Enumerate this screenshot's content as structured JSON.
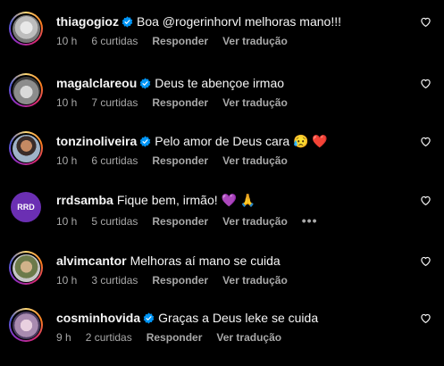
{
  "comments": [
    {
      "username": "thiagogioz",
      "verified": true,
      "text": "Boa @rogerinhorvl melhoras mano!!!",
      "time": "10 h",
      "likes": "6 curtidas",
      "reply": "Responder",
      "translate": "Ver tradução"
    },
    {
      "username": "magalclareou",
      "verified": true,
      "text": "Deus te abençoe irmao",
      "time": "10 h",
      "likes": "7 curtidas",
      "reply": "Responder",
      "translate": "Ver tradução"
    },
    {
      "username": "tonzinoliveira",
      "verified": true,
      "text": "Pelo amor de Deus cara 😥 ❤️",
      "time": "10 h",
      "likes": "6 curtidas",
      "reply": "Responder",
      "translate": "Ver tradução"
    },
    {
      "username": "rrdsamba",
      "verified": false,
      "text": "Fique bem, irmão! 💜 🙏",
      "time": "10 h",
      "likes": "5 curtidas",
      "reply": "Responder",
      "translate": "Ver tradução",
      "more": "•••",
      "avatar_text": "RRD"
    },
    {
      "username": "alvimcantor",
      "verified": false,
      "text": "Melhoras aí mano se cuida",
      "time": "10 h",
      "likes": "3 curtidas",
      "reply": "Responder",
      "translate": "Ver tradução"
    },
    {
      "username": "cosminhovida",
      "verified": true,
      "text": "Graças a Deus leke se cuida",
      "time": "9 h",
      "likes": "2 curtidas",
      "reply": "Responder",
      "translate": "Ver tradução"
    }
  ],
  "colors": {
    "background": "#000000",
    "text": "#f5f5f5",
    "meta": "#a8a8a8",
    "verified": "#0095f6"
  }
}
